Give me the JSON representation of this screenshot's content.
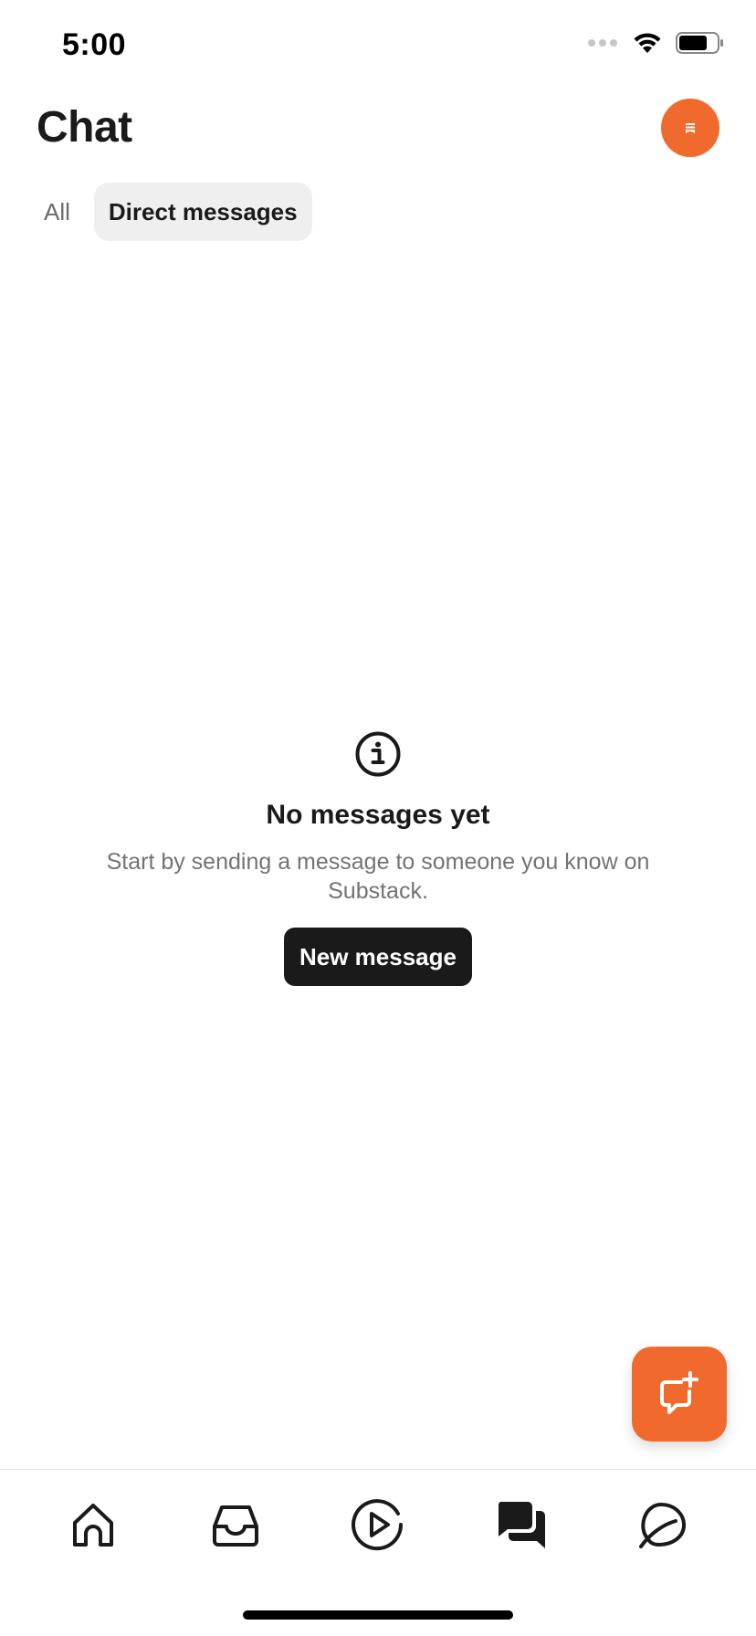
{
  "status_bar": {
    "time": "5:00"
  },
  "header": {
    "title": "Chat"
  },
  "tabs": [
    {
      "label": "All",
      "active": false
    },
    {
      "label": "Direct messages",
      "active": true
    }
  ],
  "empty_state": {
    "icon": "info-icon",
    "title": "No messages yet",
    "description": "Start by sending a message to someone you know on Substack.",
    "button_label": "New message"
  },
  "fab": {
    "icon": "new-chat-icon"
  },
  "bottom_nav": {
    "items": [
      {
        "icon": "home-icon",
        "active": false
      },
      {
        "icon": "inbox-icon",
        "active": false
      },
      {
        "icon": "play-icon",
        "active": false
      },
      {
        "icon": "chat-icon",
        "active": true
      },
      {
        "icon": "explore-icon",
        "active": false
      }
    ]
  },
  "colors": {
    "accent": "#f06a2d",
    "text_primary": "#1a1a1a",
    "text_secondary": "#737373",
    "tab_active_bg": "#efefef"
  }
}
